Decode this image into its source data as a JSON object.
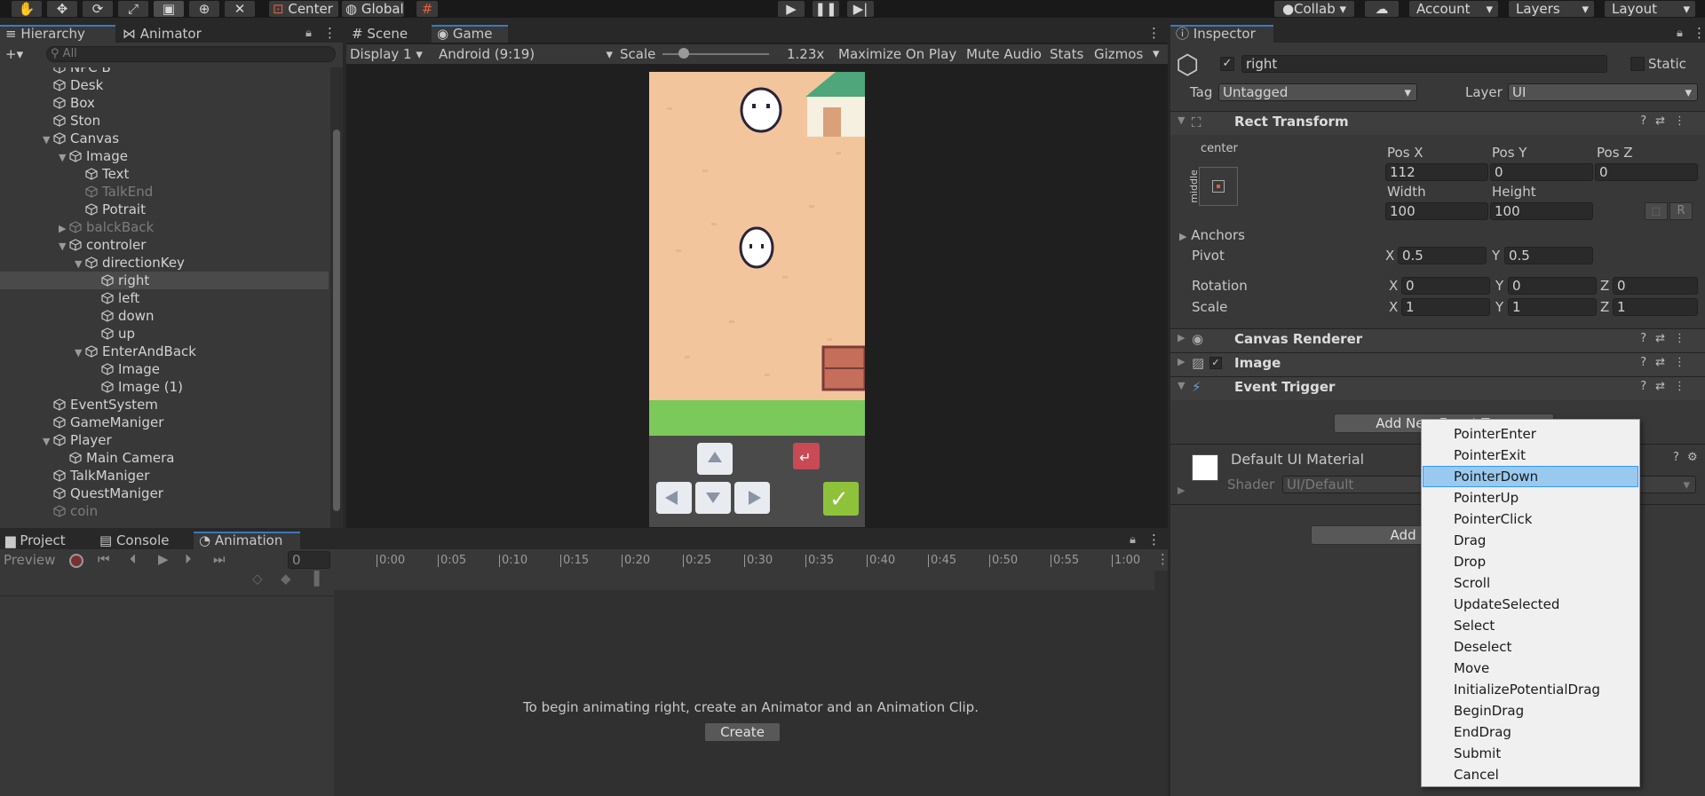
{
  "toolbar": {
    "pivot": "Center",
    "space": "Global",
    "collab": "Collab",
    "account": "Account",
    "layers": "Layers",
    "layout": "Layout"
  },
  "hierarchy": {
    "tabs": [
      "Hierarchy",
      "Animator"
    ],
    "search_placeholder": "All",
    "items": [
      {
        "label": "NPC B",
        "depth": 1,
        "expand": ""
      },
      {
        "label": "Desk",
        "depth": 1,
        "expand": ""
      },
      {
        "label": "Box",
        "depth": 1,
        "expand": ""
      },
      {
        "label": "Ston",
        "depth": 1,
        "expand": ""
      },
      {
        "label": "Canvas",
        "depth": 1,
        "expand": "open"
      },
      {
        "label": "Image",
        "depth": 2,
        "expand": "open"
      },
      {
        "label": "Text",
        "depth": 3,
        "expand": ""
      },
      {
        "label": "TalkEnd",
        "depth": 3,
        "expand": "",
        "dim": true
      },
      {
        "label": "Potrait",
        "depth": 3,
        "expand": ""
      },
      {
        "label": "balckBack",
        "depth": 2,
        "expand": "closed",
        "dim": true
      },
      {
        "label": "controler",
        "depth": 2,
        "expand": "open"
      },
      {
        "label": "directionKey",
        "depth": 3,
        "expand": "open"
      },
      {
        "label": "right",
        "depth": 4,
        "expand": "",
        "selected": true
      },
      {
        "label": "left",
        "depth": 4,
        "expand": ""
      },
      {
        "label": "down",
        "depth": 4,
        "expand": ""
      },
      {
        "label": "up",
        "depth": 4,
        "expand": ""
      },
      {
        "label": "EnterAndBack",
        "depth": 3,
        "expand": "open"
      },
      {
        "label": "Image",
        "depth": 4,
        "expand": ""
      },
      {
        "label": "Image (1)",
        "depth": 4,
        "expand": ""
      },
      {
        "label": "EventSystem",
        "depth": 1,
        "expand": ""
      },
      {
        "label": "GameManiger",
        "depth": 1,
        "expand": ""
      },
      {
        "label": "Player",
        "depth": 1,
        "expand": "open"
      },
      {
        "label": "Main Camera",
        "depth": 2,
        "expand": ""
      },
      {
        "label": "TalkManiger",
        "depth": 1,
        "expand": ""
      },
      {
        "label": "QuestManiger",
        "depth": 1,
        "expand": ""
      },
      {
        "label": "coin",
        "depth": 1,
        "expand": "",
        "dim": true
      }
    ]
  },
  "game": {
    "tabs": [
      "Scene",
      "Game"
    ],
    "display": "Display 1",
    "aspect": "Android (9:19)",
    "scale_label": "Scale",
    "scale_value": "1.23x",
    "scale_level": 0.1,
    "buttons": [
      "Maximize On Play",
      "Mute Audio",
      "Stats",
      "Gizmos"
    ]
  },
  "animation": {
    "tabs": [
      "Project",
      "Console",
      "Animation"
    ],
    "preview": "Preview",
    "frame": "0",
    "ticks": [
      "0:00",
      "0:05",
      "0:10",
      "0:15",
      "0:20",
      "0:25",
      "0:30",
      "0:35",
      "0:40",
      "0:45",
      "0:50",
      "0:55",
      "1:00"
    ],
    "message": "To begin animating right, create an Animator and an Animation Clip.",
    "create": "Create"
  },
  "inspector": {
    "tab": "Inspector",
    "object_name": "right",
    "static": "Static",
    "tag_label": "Tag",
    "tag": "Untagged",
    "layer_label": "Layer",
    "layer": "UI",
    "rect_transform": "Rect Transform",
    "anchor_h": "center",
    "anchor_v": "middle",
    "posx_label": "Pos X",
    "posx": "112",
    "posy_label": "Pos Y",
    "posy": "0",
    "posz_label": "Pos Z",
    "posz": "0",
    "width_label": "Width",
    "width": "100",
    "height_label": "Height",
    "height": "100",
    "anchors": "Anchors",
    "pivot": "Pivot",
    "pivot_x": "0.5",
    "pivot_y": "0.5",
    "rotation": "Rotation",
    "rot_x": "0",
    "rot_y": "0",
    "rot_z": "0",
    "scale": "Scale",
    "scale_x": "1",
    "scale_y": "1",
    "scale_z": "1",
    "canvas_renderer": "Canvas Renderer",
    "image": "Image",
    "event_trigger": "Event Trigger",
    "add_new": "Add New Event Type",
    "material": "Default UI Material",
    "shader_label": "Shader",
    "shader": "UI/Default",
    "add_component": "Add Component"
  },
  "menu": {
    "items": [
      "PointerEnter",
      "PointerExit",
      "PointerDown",
      "PointerUp",
      "PointerClick",
      "Drag",
      "Drop",
      "Scroll",
      "UpdateSelected",
      "Select",
      "Deselect",
      "Move",
      "InitializePotentialDrag",
      "BeginDrag",
      "EndDrag",
      "Submit",
      "Cancel"
    ],
    "highlighted": 2
  },
  "colors": {
    "accent": "#3a79bb",
    "menu_highlight": "#99c9ef"
  }
}
